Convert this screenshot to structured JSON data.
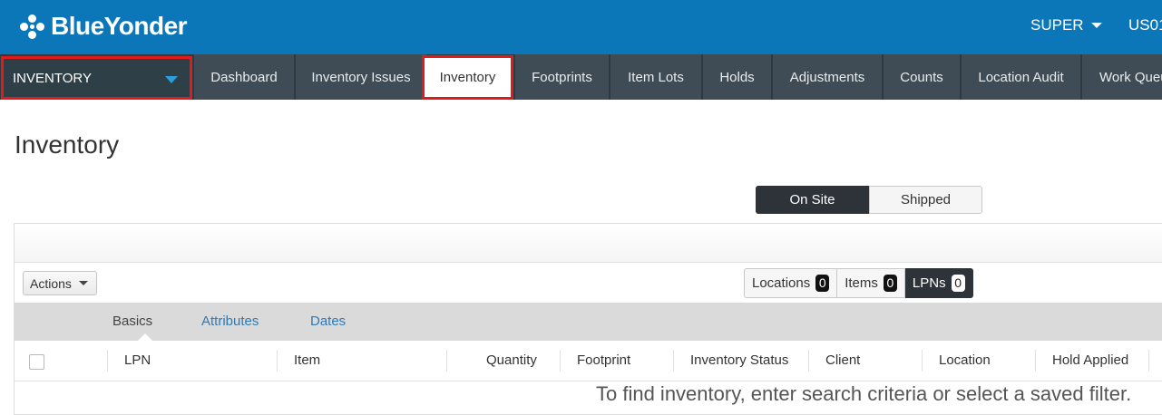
{
  "brand": {
    "name": "BlueYonder"
  },
  "header": {
    "user": "SUPER",
    "site": "US01"
  },
  "module_selector": {
    "label": "INVENTORY"
  },
  "nav": {
    "tabs": [
      {
        "label": "Dashboard"
      },
      {
        "label": "Inventory Issues"
      },
      {
        "label": "Inventory"
      },
      {
        "label": "Footprints"
      },
      {
        "label": "Item Lots"
      },
      {
        "label": "Holds"
      },
      {
        "label": "Adjustments"
      },
      {
        "label": "Counts"
      },
      {
        "label": "Location Audit"
      },
      {
        "label": "Work Queue"
      }
    ],
    "active": "Inventory"
  },
  "page": {
    "title": "Inventory"
  },
  "toggle": {
    "on_site": "On Site",
    "shipped": "Shipped",
    "selected": "On Site"
  },
  "toolbar": {
    "actions_label": "Actions"
  },
  "counters": [
    {
      "label": "Locations",
      "count": "0"
    },
    {
      "label": "Items",
      "count": "0"
    },
    {
      "label": "LPNs",
      "count": "0"
    }
  ],
  "subtabs": [
    {
      "label": "Basics"
    },
    {
      "label": "Attributes"
    },
    {
      "label": "Dates"
    }
  ],
  "columns": [
    "LPN",
    "Item",
    "Quantity",
    "Footprint",
    "Inventory Status",
    "Client",
    "Location",
    "Hold Applied"
  ],
  "empty_message": "To find inventory, enter search criteria or select a saved filter.",
  "colors": {
    "header_blue": "#0b77b9",
    "nav_dark": "#2c3a43",
    "highlight_red": "#e01b1b",
    "link_blue": "#2f7ab7"
  }
}
